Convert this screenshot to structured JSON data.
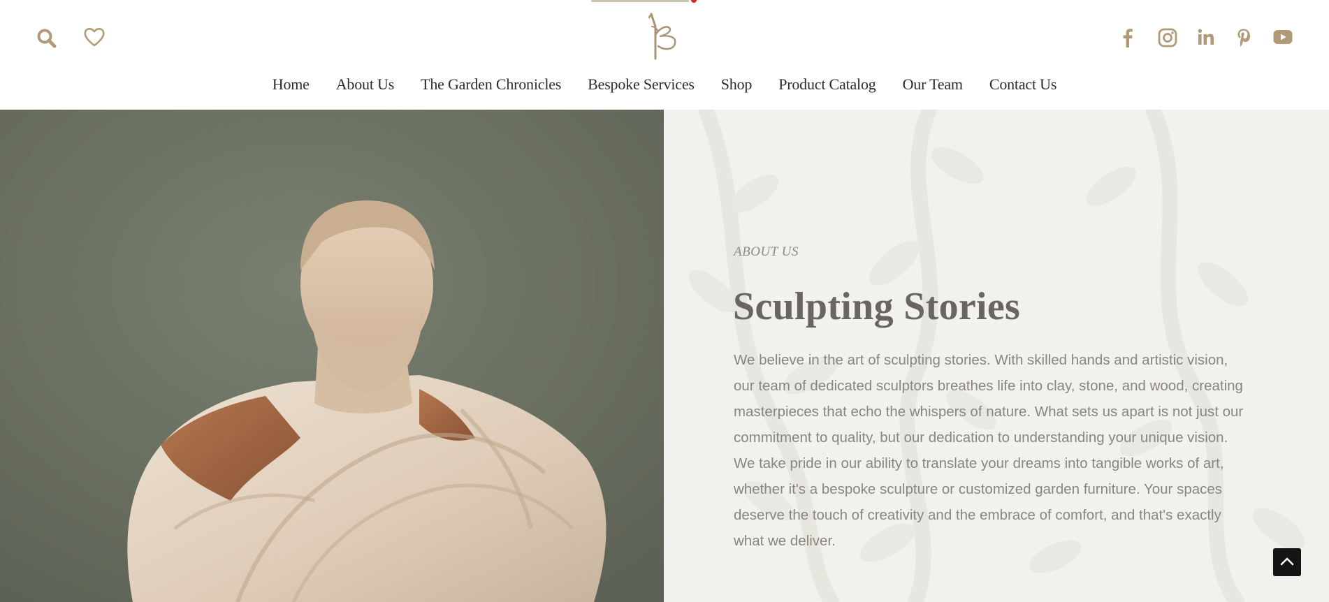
{
  "colors": {
    "accent": "#b09a78",
    "nav_text": "#2b2b2b",
    "panel_bg": "#f1f1ee",
    "photo_bg": "#6e7365",
    "title": "#6a655e",
    "body_text": "#8a857e",
    "scroll_button": "#141414"
  },
  "header": {
    "left_icons": [
      "search-icon",
      "heart-icon"
    ],
    "logo": "kb-monogram-logo",
    "social_icons": [
      "facebook-icon",
      "instagram-icon",
      "linkedin-icon",
      "pinterest-icon",
      "youtube-icon"
    ]
  },
  "nav": {
    "items": [
      {
        "label": "Home"
      },
      {
        "label": "About Us"
      },
      {
        "label": "The Garden Chronicles"
      },
      {
        "label": "Bespoke Services"
      },
      {
        "label": "Shop"
      },
      {
        "label": "Product Catalog"
      },
      {
        "label": "Our Team"
      },
      {
        "label": "Contact Us"
      }
    ]
  },
  "hero": {
    "image": "marble-bust-sculpture",
    "eyebrow": "ABOUT US",
    "title": "Sculpting Stories",
    "body": "We believe in the art of sculpting stories. With skilled hands and artistic vision, our team of dedicated sculptors breathes life into clay, stone, and wood, creating masterpieces that echo the whispers of nature. What sets us apart is not just our commitment to quality, but our dedication to understanding your unique vision. We take pride in our ability to translate your dreams into tangible works of art, whether it's a bespoke sculpture or customized garden furniture. Your spaces deserve the touch of creativity and the embrace of comfort, and that's exactly what we deliver."
  },
  "scroll_top": {
    "icon": "chevron-up-icon"
  }
}
